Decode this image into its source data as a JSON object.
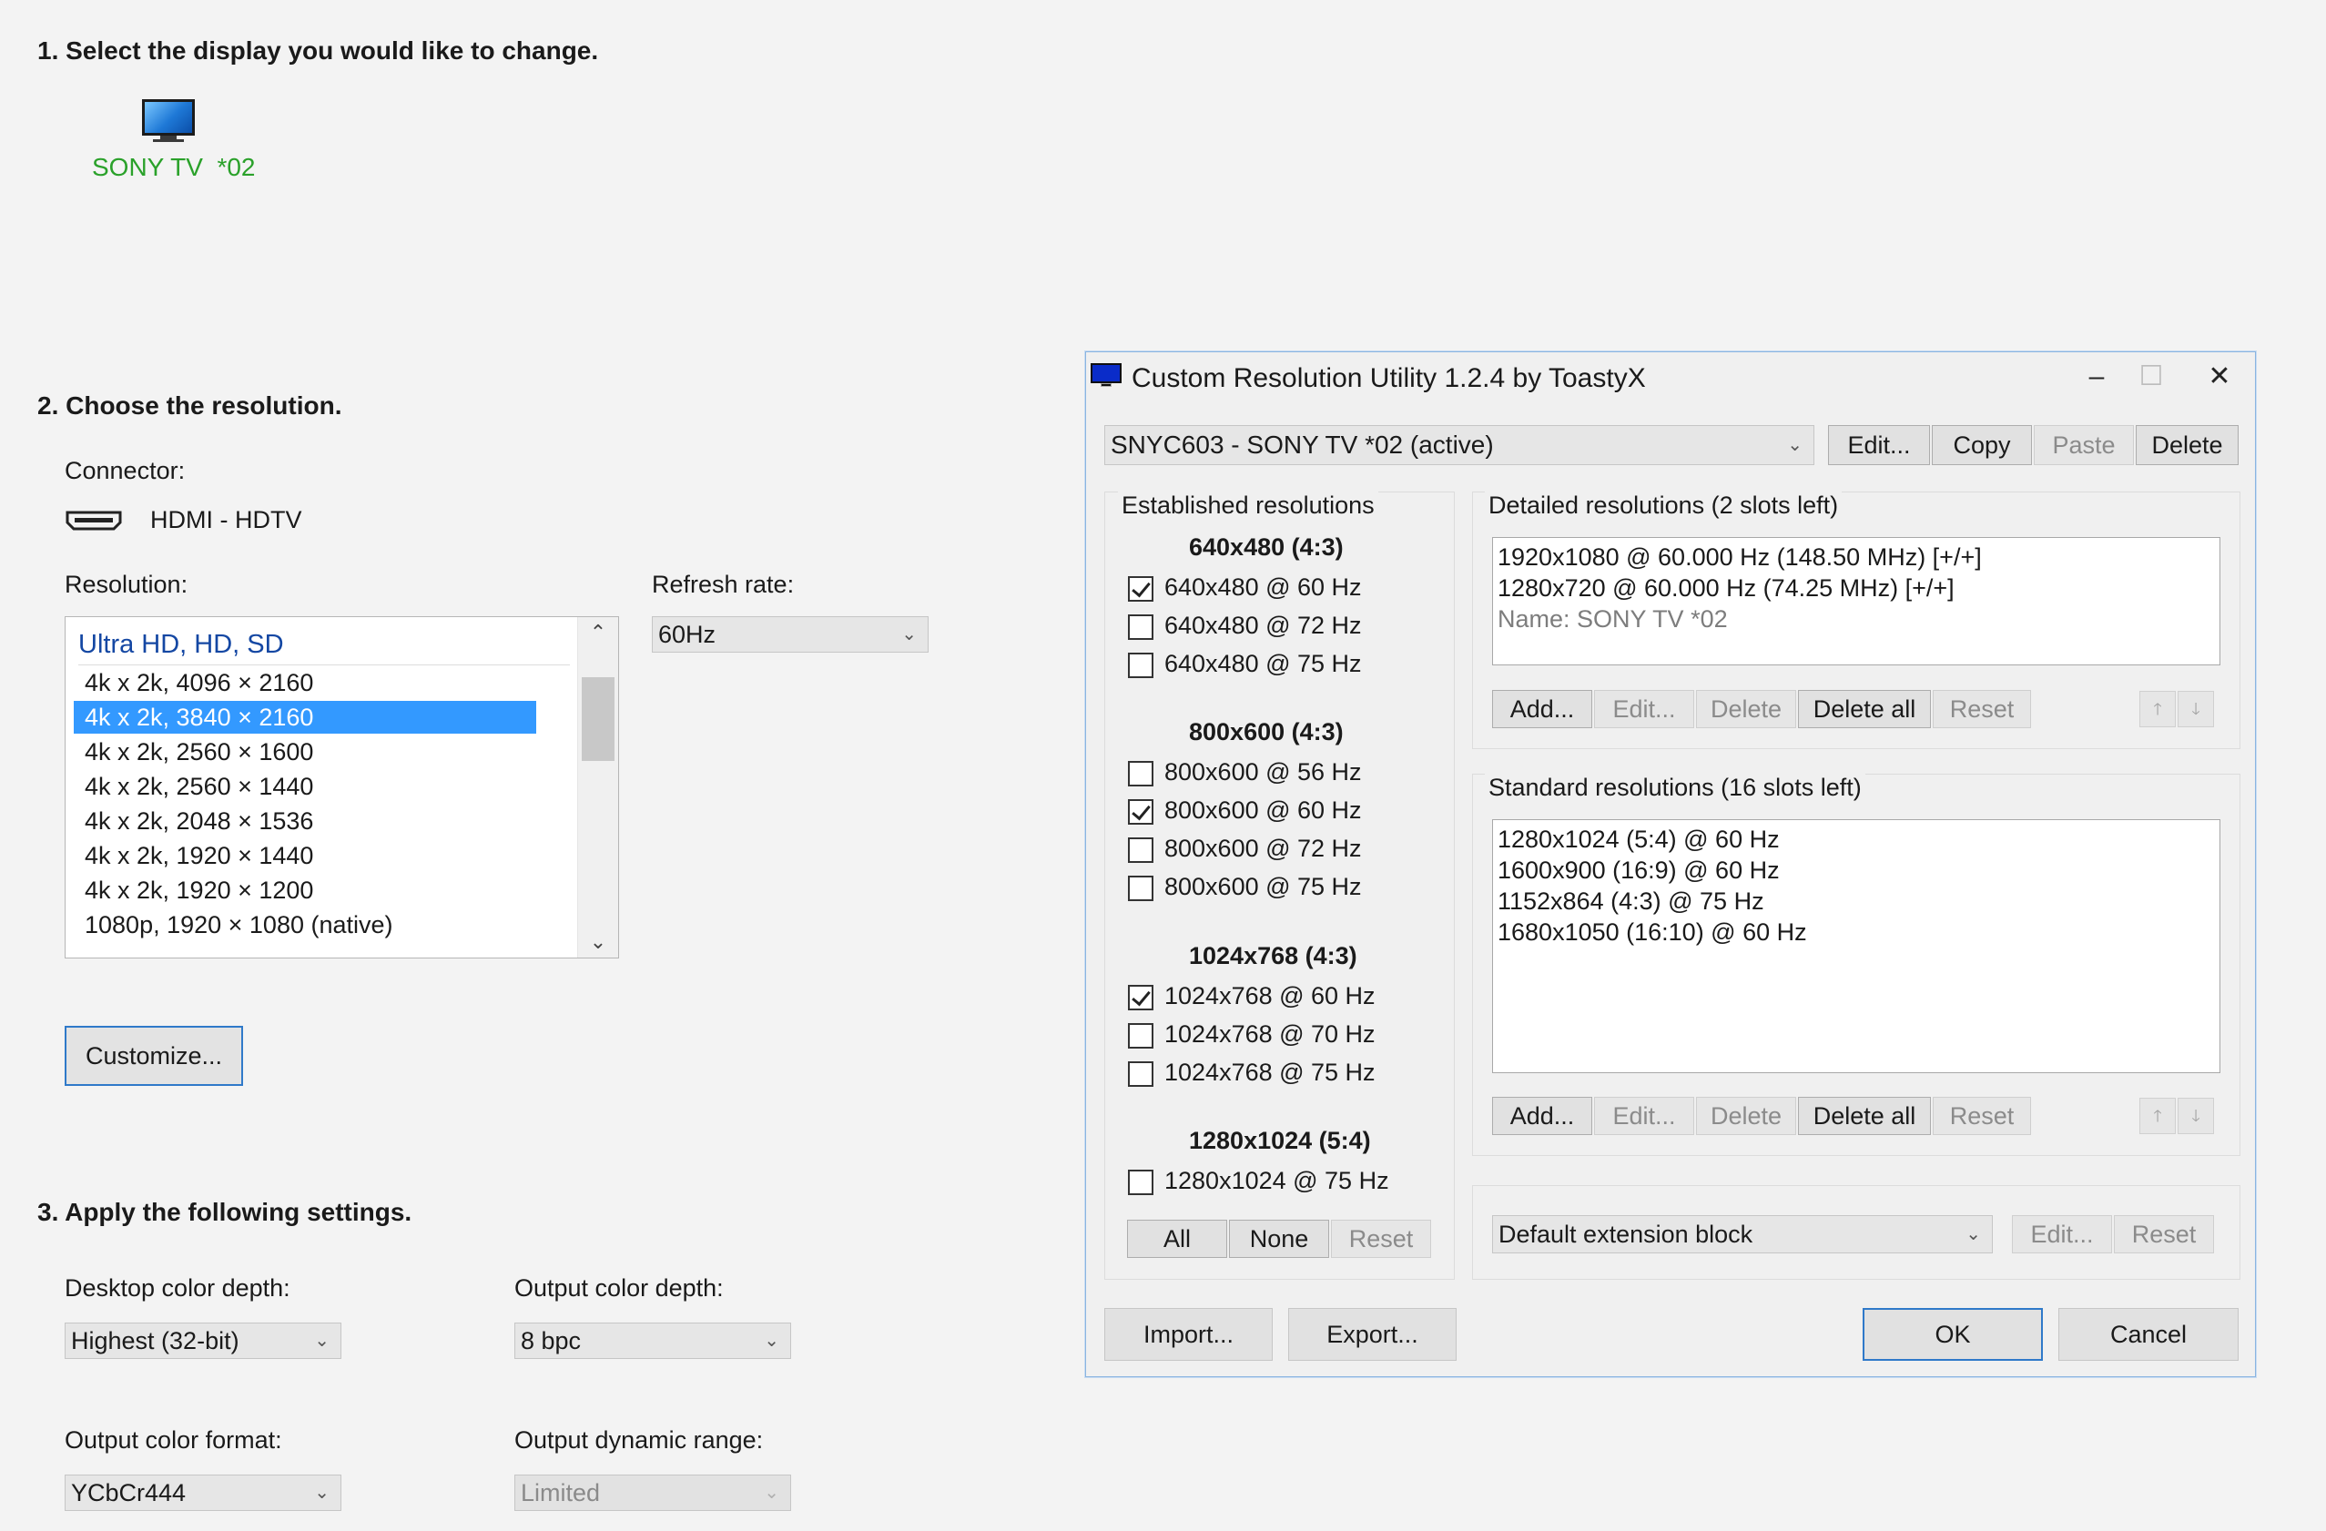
{
  "section1": {
    "title": "1. Select the display you would like to change.",
    "display_name": "SONY TV  *02"
  },
  "section2": {
    "title": "2. Choose the resolution.",
    "connector_label": "Connector:",
    "connector_value": "HDMI - HDTV",
    "resolution_label": "Resolution:",
    "refresh_label": "Refresh rate:",
    "refresh_value": "60Hz",
    "list_group": "Ultra HD, HD, SD",
    "items": [
      "4k x 2k, 4096 × 2160",
      "4k x 2k, 3840 × 2160",
      "4k x 2k, 2560 × 1600",
      "4k x 2k, 2560 × 1440",
      "4k x 2k, 2048 × 1536",
      "4k x 2k, 1920 × 1440",
      "4k x 2k, 1920 × 1200",
      "1080p, 1920 × 1080 (native)"
    ],
    "selected_item": "4k x 2k, 3840 × 2160",
    "customize_label": "Customize..."
  },
  "section3": {
    "title": "3. Apply the following settings.",
    "desktop_color_depth_label": "Desktop color depth:",
    "desktop_color_depth_value": "Highest (32-bit)",
    "output_color_depth_label": "Output color depth:",
    "output_color_depth_value": "8 bpc",
    "output_color_format_label": "Output color format:",
    "output_color_format_value": "YCbCr444",
    "output_dynamic_range_label": "Output dynamic range:",
    "output_dynamic_range_value": "Limited"
  },
  "dialog": {
    "title": "Custom Resolution Utility 1.2.4 by ToastyX",
    "minimize": "–",
    "maximize": "☐",
    "close": "✕",
    "monitor_select": "SNYC603 - SONY TV  *02 (active)",
    "top_buttons": {
      "edit": "Edit...",
      "copy": "Copy",
      "paste": "Paste",
      "delete": "Delete"
    },
    "established": {
      "title": "Established resolutions",
      "groups": [
        {
          "header": "640x480 (4:3)",
          "items": [
            {
              "label": "640x480 @ 60 Hz",
              "checked": true
            },
            {
              "label": "640x480 @ 72 Hz",
              "checked": false
            },
            {
              "label": "640x480 @ 75 Hz",
              "checked": false
            }
          ]
        },
        {
          "header": "800x600 (4:3)",
          "items": [
            {
              "label": "800x600 @ 56 Hz",
              "checked": false
            },
            {
              "label": "800x600 @ 60 Hz",
              "checked": true
            },
            {
              "label": "800x600 @ 72 Hz",
              "checked": false
            },
            {
              "label": "800x600 @ 75 Hz",
              "checked": false
            }
          ]
        },
        {
          "header": "1024x768 (4:3)",
          "items": [
            {
              "label": "1024x768 @ 60 Hz",
              "checked": true
            },
            {
              "label": "1024x768 @ 70 Hz",
              "checked": false
            },
            {
              "label": "1024x768 @ 75 Hz",
              "checked": false
            }
          ]
        },
        {
          "header": "1280x1024 (5:4)",
          "items": [
            {
              "label": "1280x1024 @ 75 Hz",
              "checked": false
            }
          ]
        }
      ],
      "buttons": {
        "all": "All",
        "none": "None",
        "reset": "Reset"
      }
    },
    "detailed": {
      "title": "Detailed resolutions (2 slots left)",
      "lines": [
        "1920x1080 @ 60.000 Hz (148.50 MHz) [+/+]",
        "1280x720 @ 60.000 Hz (74.25 MHz) [+/+]",
        "Name: SONY TV  *02"
      ],
      "buttons": {
        "add": "Add...",
        "edit": "Edit...",
        "delete": "Delete",
        "delete_all": "Delete all",
        "reset": "Reset"
      },
      "up": "🡑",
      "down": "🡓"
    },
    "standard": {
      "title": "Standard resolutions (16 slots left)",
      "lines": [
        "1280x1024 (5:4) @ 60 Hz",
        "1600x900 (16:9) @ 60 Hz",
        "1152x864 (4:3) @ 75 Hz",
        "1680x1050 (16:10) @ 60 Hz"
      ],
      "buttons": {
        "add": "Add...",
        "edit": "Edit...",
        "delete": "Delete",
        "delete_all": "Delete all",
        "reset": "Reset"
      },
      "up": "🡑",
      "down": "🡓"
    },
    "extension": {
      "select": "Default extension block",
      "edit": "Edit...",
      "reset": "Reset"
    },
    "bottom": {
      "import": "Import...",
      "export": "Export...",
      "ok": "OK",
      "cancel": "Cancel"
    }
  }
}
